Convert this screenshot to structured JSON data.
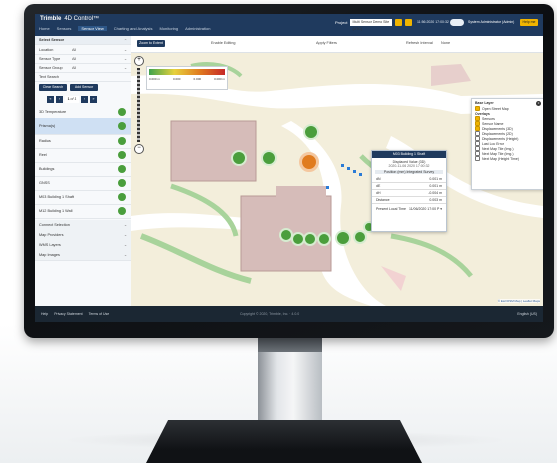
{
  "header": {
    "logo": "Trimble",
    "app_name": "4D Control™",
    "nav": [
      "Home",
      "Sensors",
      "Sensor View",
      "Charting and Analysis",
      "Monitoring",
      "Administration"
    ],
    "active_nav": "Sensor View",
    "project_label": "Project",
    "project_value": "Multi Sensor Demo Site (UTC)",
    "clock": "11:56:2020 17:00:32",
    "user": "System Administrator (Admin)",
    "help": "Help me"
  },
  "sidebar": {
    "title": "Select Sensor",
    "filters": [
      {
        "label": "Location",
        "value": "All"
      },
      {
        "label": "Sensor Type",
        "value": "All"
      },
      {
        "label": "Sensor Group",
        "value": "All"
      }
    ],
    "text_search_label": "Text Search",
    "clear_search": "Clear Search",
    "add_sensor": "Add Sensor",
    "page_current": "1",
    "page_total": "of 1",
    "sensors": [
      "3D Temperature",
      "Prisma(s)",
      "Radius",
      "Reel",
      "Buildings",
      "GNSS",
      "M03 Building 1 Shaft",
      "M12 Building 1 Wall"
    ],
    "selected_sensor": "Prisma(s)",
    "bottom_sections": [
      "Connect Selection",
      "Map Providers",
      "WMS Layers",
      "Map Images"
    ]
  },
  "map": {
    "toolbar_button": "Zoom to Extent",
    "toolbar_items": [
      "Enable Editing",
      "Apply Filters",
      "Refresh Interval"
    ],
    "refresh_value": "None",
    "legend_values": [
      "0.000 m",
      "0.000",
      "0.000",
      "0.000 m"
    ],
    "attribution": "© Esri/OSM Map | Leaflet Maps"
  },
  "popup": {
    "title": "M03 Building 1 Shaft",
    "subtitle": "Displaced Value (3D)",
    "timestamp": "2020-11-06 2020 17:00:32",
    "metric": "Position (mm) Integrated Survey",
    "rows": [
      {
        "label": "dN",
        "value": "0.001 m"
      },
      {
        "label": "dE",
        "value": "0.001 m"
      },
      {
        "label": "dH",
        "value": "-0.004 m"
      },
      {
        "label": "Distance",
        "value": "0.003 m"
      }
    ],
    "footer_label": "Present Local Time",
    "footer_value": "11/06/2020 17:00 P ▾"
  },
  "layers": {
    "base_title": "Base Layer",
    "base_items": [
      "Open Street Map"
    ],
    "overlays_title": "Overlays",
    "overlay_items": [
      "Sensors",
      "Sensor Name",
      "Displacements (3D)",
      "Displacements (2D)",
      "Displacements (Height)",
      "Last Loc Error",
      "Next Map Tile (Img.)",
      "Next Map Tile (Img.)",
      "Next Map (Height Time)"
    ]
  },
  "footer": {
    "links": [
      "Help",
      "Privacy Statement",
      "Terms of Use"
    ],
    "copyright": "Copyright © 2020, Trimble, Inc. · 4.0.0",
    "language": "English (US)"
  },
  "colors": {
    "brand": "#1f3a5e",
    "accent": "#f0b400",
    "sensor_ok": "#4a9e3c",
    "alert": "#e07b1f"
  }
}
